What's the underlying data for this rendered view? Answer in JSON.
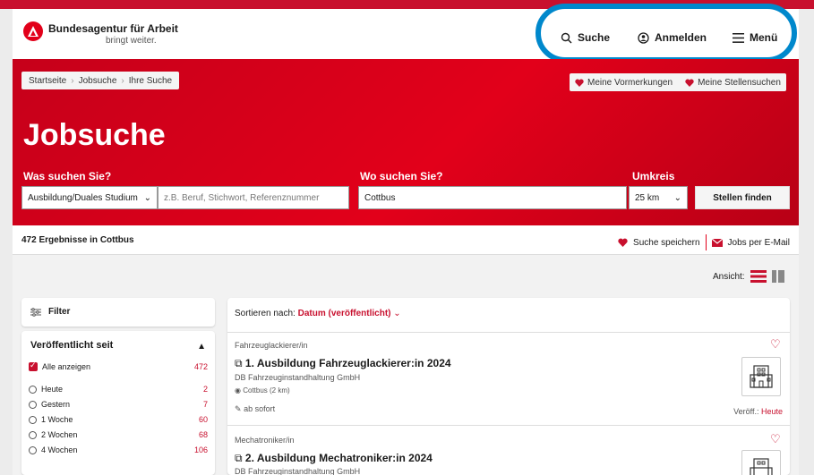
{
  "header": {
    "brand_name": "Bundesagentur für Arbeit",
    "brand_tagline": "bringt weiter.",
    "nav": {
      "search": "Suche",
      "login": "Anmelden",
      "menu": "Menü"
    }
  },
  "breadcrumb": [
    "Startseite",
    "Jobsuche",
    "Ihre Suche"
  ],
  "saved_links": {
    "bookmarks": "Meine Vormerkungen",
    "searches": "Meine Stellensuchen"
  },
  "hero": {
    "title": "Jobsuche",
    "what_label": "Was suchen Sie?",
    "where_label": "Wo suchen Sie?",
    "radius_label": "Umkreis",
    "type_value": "Ausbildung/Duales Studium",
    "query_placeholder": "z.B. Beruf, Stichwort, Referenznummer",
    "location_value": "Cottbus",
    "radius_value": "25 km",
    "find_button": "Stellen finden"
  },
  "results": {
    "count_text": "472 Ergebnisse in Cottbus",
    "save_search": "Suche speichern",
    "jobs_by_email": "Jobs per E-Mail",
    "view_label": "Ansicht:"
  },
  "filter": {
    "label": "Filter",
    "published_title": "Veröffentlicht seit",
    "options": [
      {
        "label": "Alle anzeigen",
        "count": "472"
      },
      {
        "label": "Heute",
        "count": "2"
      },
      {
        "label": "Gestern",
        "count": "7"
      },
      {
        "label": "1 Woche",
        "count": "60"
      },
      {
        "label": "2 Wochen",
        "count": "68"
      },
      {
        "label": "4 Wochen",
        "count": "106"
      }
    ]
  },
  "sort": {
    "label": "Sortieren nach:",
    "value": "Datum (veröffentlicht)"
  },
  "jobs": [
    {
      "category": "Fahrzeuglackierer/in",
      "title": "1. Ausbildung Fahrzeuglackierer:in 2024",
      "company": "DB Fahrzeuginstandhaltung GmbH",
      "location": "Cottbus (2 km)",
      "start": "ab sofort",
      "published_label": "Veröff.:",
      "published_value": "Heute"
    },
    {
      "category": "Mechatroniker/in",
      "title": "2. Ausbildung Mechatroniker:in 2024",
      "company": "DB Fahrzeuginstandhaltung GmbH"
    }
  ],
  "colors": {
    "brand_red": "#e2001a",
    "highlight_blue": "#0088cc"
  }
}
